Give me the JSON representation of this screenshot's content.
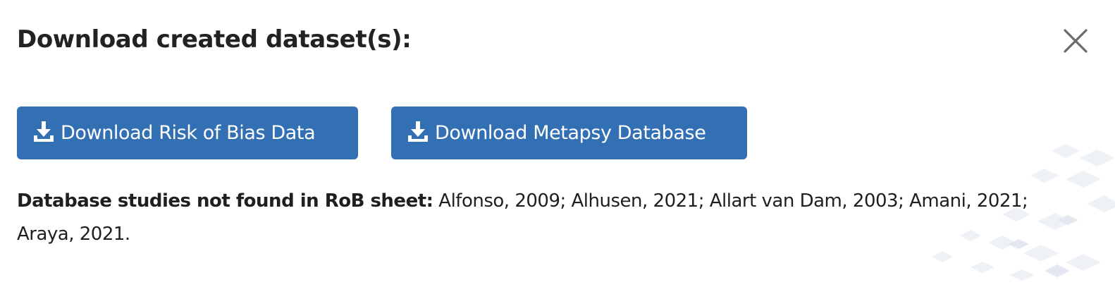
{
  "dialog": {
    "title": "Download created dataset(s):",
    "close_icon": "close-icon"
  },
  "buttons": {
    "rob": {
      "label": "Download Risk of Bias Data",
      "icon": "download-icon"
    },
    "metapsy": {
      "label": "Download Metapsy Database",
      "icon": "download-icon"
    }
  },
  "notice": {
    "label": "Database studies not found in RoB sheet:",
    "text": " Alfonso, 2009; Alhusen, 2021; Allart van Dam, 2003; Amani, 2021; Araya, 2021."
  },
  "colors": {
    "button_bg": "#3370b3",
    "button_text": "#ffffff",
    "title_text": "#222222",
    "body_text": "#1f1f1f",
    "close_icon": "#6b6b6b"
  }
}
